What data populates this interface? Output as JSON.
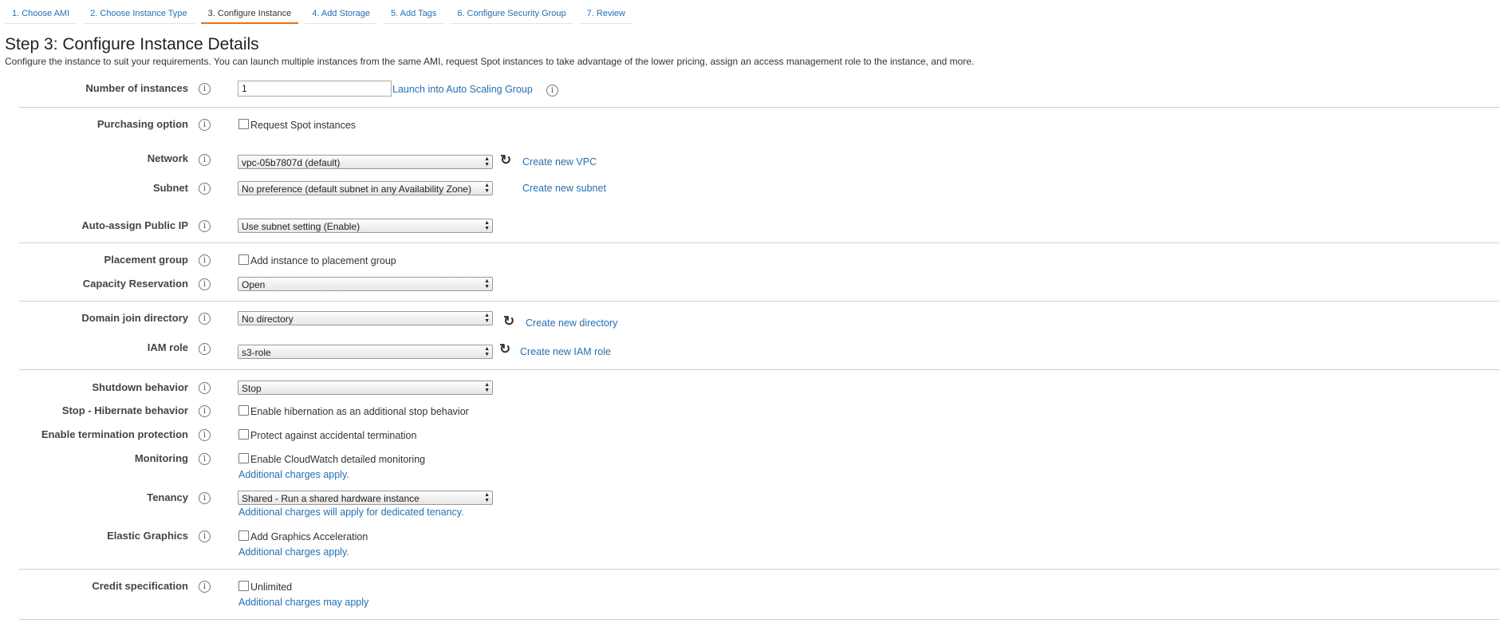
{
  "tabs": [
    {
      "label": "1. Choose AMI"
    },
    {
      "label": "2. Choose Instance Type"
    },
    {
      "label": "3. Configure Instance"
    },
    {
      "label": "4. Add Storage"
    },
    {
      "label": "5. Add Tags"
    },
    {
      "label": "6. Configure Security Group"
    },
    {
      "label": "7. Review"
    }
  ],
  "page": {
    "title": "Step 3: Configure Instance Details",
    "description": "Configure the instance to suit your requirements. You can launch multiple instances from the same AMI, request Spot instances to take advantage of the lower pricing, assign an access management role to the instance, and more."
  },
  "info_glyph": "i",
  "refresh_glyph": "↻",
  "select_arrows": "▲▼",
  "fields": {
    "number_of_instances": {
      "label": "Number of instances",
      "value": "1",
      "link": "Launch into Auto Scaling Group"
    },
    "purchasing_option": {
      "label": "Purchasing option",
      "checkbox": "Request Spot instances"
    },
    "network": {
      "label": "Network",
      "value": "vpc-05b7807d (default)",
      "link": "Create new VPC"
    },
    "subnet": {
      "label": "Subnet",
      "value": "No preference (default subnet in any Availability Zone)",
      "link": "Create new subnet"
    },
    "auto_assign_public_ip": {
      "label": "Auto-assign Public IP",
      "value": "Use subnet setting (Enable)"
    },
    "placement_group": {
      "label": "Placement group",
      "checkbox": "Add instance to placement group"
    },
    "capacity_reservation": {
      "label": "Capacity Reservation",
      "value": "Open"
    },
    "domain_join_directory": {
      "label": "Domain join directory",
      "value": "No directory",
      "link": "Create new directory"
    },
    "iam_role": {
      "label": "IAM role",
      "value": "s3-role",
      "link": "Create new IAM role"
    },
    "shutdown_behavior": {
      "label": "Shutdown behavior",
      "value": "Stop"
    },
    "stop_hibernate": {
      "label": "Stop - Hibernate behavior",
      "checkbox": "Enable hibernation as an additional stop behavior"
    },
    "termination_protection": {
      "label": "Enable termination protection",
      "checkbox": "Protect against accidental termination"
    },
    "monitoring": {
      "label": "Monitoring",
      "checkbox": "Enable CloudWatch detailed monitoring",
      "note": "Additional charges apply."
    },
    "tenancy": {
      "label": "Tenancy",
      "value": "Shared - Run a shared hardware instance",
      "note": "Additional charges will apply for dedicated tenancy."
    },
    "elastic_graphics": {
      "label": "Elastic Graphics",
      "checkbox": "Add Graphics Acceleration",
      "note": "Additional charges apply."
    },
    "credit_specification": {
      "label": "Credit specification",
      "checkbox": "Unlimited",
      "note": "Additional charges may apply"
    }
  },
  "colors": {
    "link": "#2470b3",
    "active_tab_underline": "#ec7211"
  }
}
